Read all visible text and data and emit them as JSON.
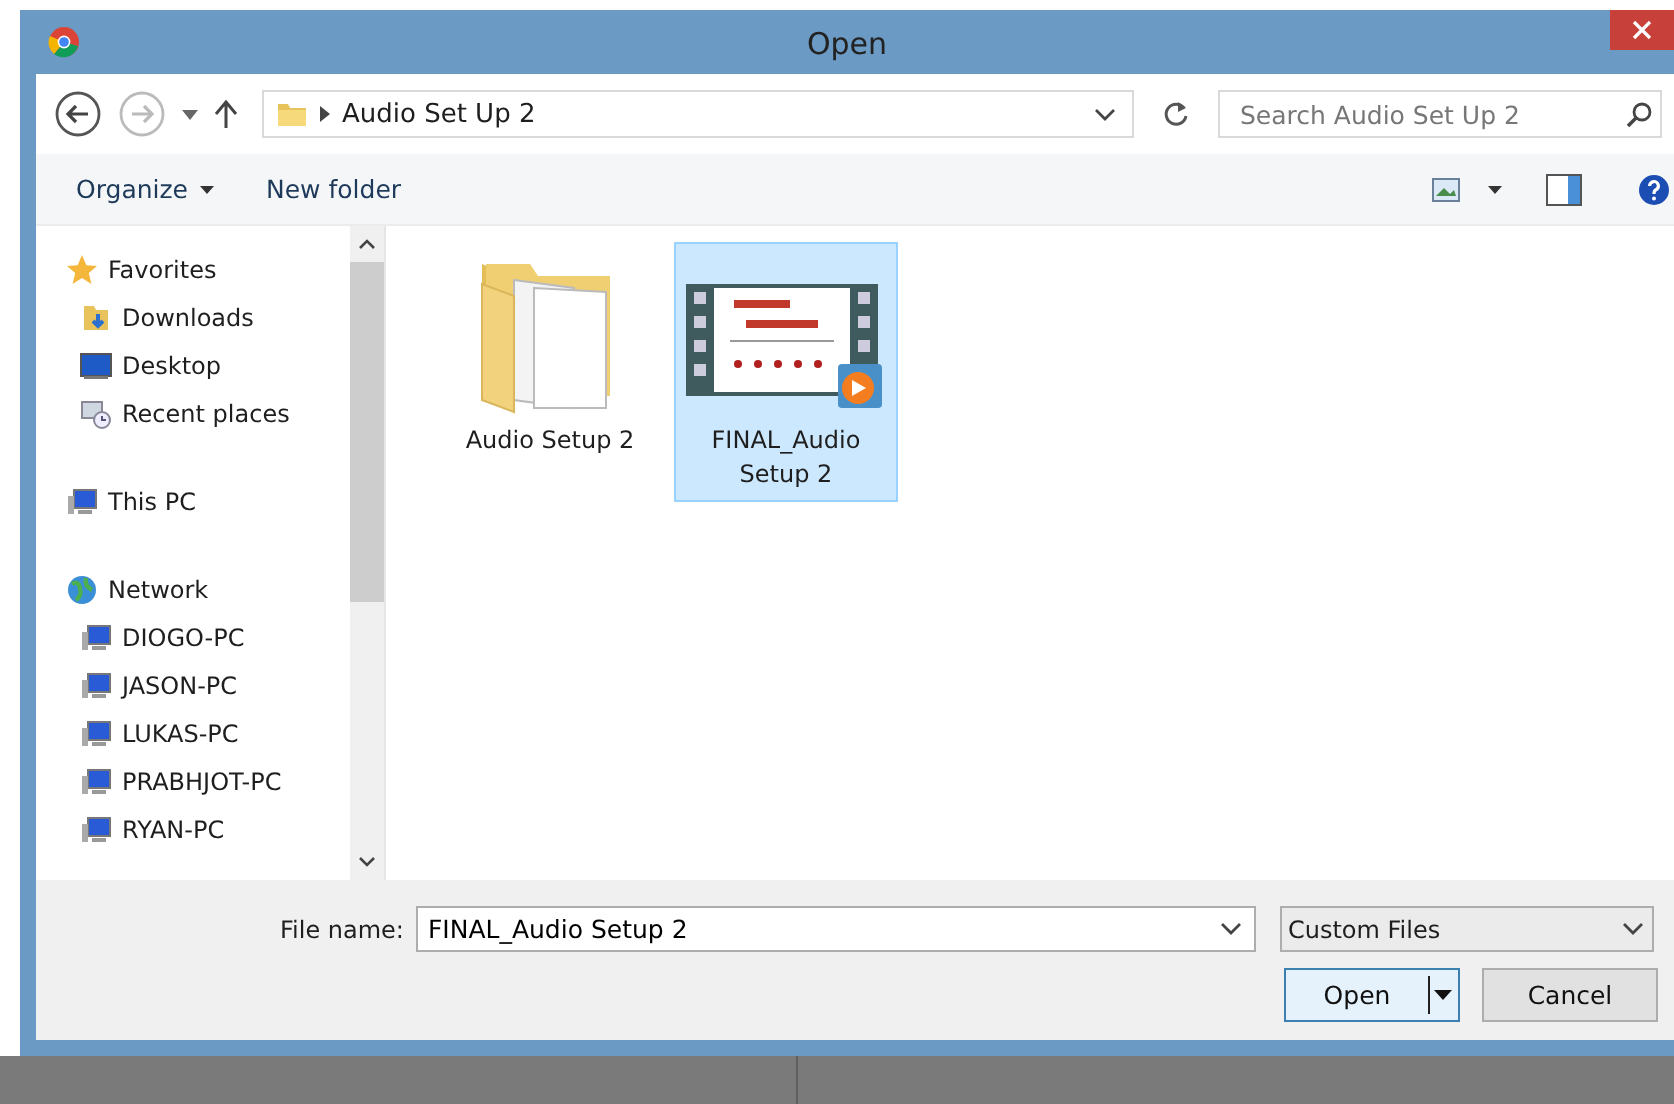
{
  "window": {
    "title": "Open"
  },
  "address_bar": {
    "path": "Audio Set Up 2",
    "search_placeholder": "Search Audio Set Up 2"
  },
  "toolbar": [
    {
      "label": "Organize",
      "kind": "menu"
    },
    {
      "label": "New folder",
      "kind": "button"
    }
  ],
  "sidebar": {
    "items": [
      {
        "label": "Favorites",
        "kind": "star",
        "children": [
          {
            "label": "Downloads",
            "kind": "downloads"
          },
          {
            "label": "Desktop",
            "kind": "desktop"
          },
          {
            "label": "Recent places",
            "kind": "recent"
          }
        ]
      },
      {
        "label": "This PC",
        "kind": "pc"
      },
      {
        "label": "Network",
        "kind": "network",
        "children": [
          {
            "label": "DIOGO-PC",
            "kind": "pc"
          },
          {
            "label": "JASON-PC",
            "kind": "pc"
          },
          {
            "label": "LUKAS-PC",
            "kind": "pc"
          },
          {
            "label": "PRABHJOT-PC",
            "kind": "pc"
          },
          {
            "label": "RYAN-PC",
            "kind": "pc"
          }
        ]
      }
    ]
  },
  "files": [
    {
      "name": "Audio Setup 2",
      "kind": "folder",
      "selected": false
    },
    {
      "name": "FINAL_Audio Setup 2",
      "kind": "video",
      "selected": true
    }
  ],
  "footer": {
    "file_name_label": "File name:",
    "file_name": "FINAL_Audio Setup 2",
    "file_type": "Custom Files",
    "buttons": [
      {
        "label": "Open",
        "kind": "split"
      },
      {
        "label": "Cancel",
        "kind": "plain"
      }
    ]
  }
}
